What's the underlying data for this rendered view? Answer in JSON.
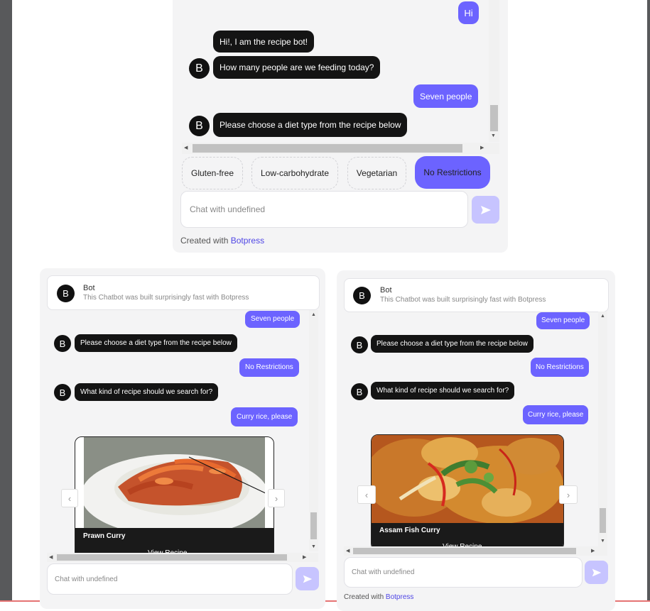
{
  "top_chat": {
    "messages": [
      {
        "from": "user",
        "text": "Hi"
      },
      {
        "from": "bot",
        "text": "Hi!, I am the recipe bot!"
      },
      {
        "from": "bot",
        "text": "How many people are we feeding today?"
      },
      {
        "from": "user",
        "text": "Seven people"
      },
      {
        "from": "bot",
        "text": "Please choose a diet type from the recipe below"
      }
    ],
    "avatar_letter": "B",
    "choices": [
      "Gluten-free",
      "Low-carbohydrate",
      "Vegetarian",
      "No Restrictions"
    ],
    "selected_choice": "No Restrictions",
    "input_placeholder": "Chat with undefined",
    "footer_prefix": "Created with",
    "footer_link": "Botpress"
  },
  "left_chat": {
    "header_name": "Bot",
    "header_desc": "This Chatbot was built surprisingly fast with Botpress",
    "avatar_letter": "B",
    "messages": [
      {
        "from": "user",
        "text": "Seven people"
      },
      {
        "from": "bot",
        "text": "Please choose a diet type from the recipe below"
      },
      {
        "from": "user",
        "text": "No Restrictions"
      },
      {
        "from": "bot",
        "text": "What kind of recipe should we search for?"
      },
      {
        "from": "user",
        "text": "Curry rice, please"
      }
    ],
    "card_title": "Prawn Curry",
    "card_link": "View Recipe",
    "input_placeholder": "Chat with undefined"
  },
  "right_chat": {
    "header_name": "Bot",
    "header_desc": "This Chatbot was built surprisingly fast with Botpress",
    "avatar_letter": "B",
    "messages": [
      {
        "from": "user",
        "text": "Seven people"
      },
      {
        "from": "bot",
        "text": "Please choose a diet type from the recipe below"
      },
      {
        "from": "user",
        "text": "No Restrictions"
      },
      {
        "from": "bot",
        "text": "What kind of recipe should we search for?"
      },
      {
        "from": "user",
        "text": "Curry rice, please"
      }
    ],
    "card_title": "Assam Fish Curry",
    "card_link": "View Recipe",
    "input_placeholder": "Chat with undefined",
    "footer_prefix": "Created with",
    "footer_link": "Botpress"
  },
  "colors": {
    "accent": "#6c63ff",
    "bot_bubble": "#141414",
    "panel": "#f4f4f5",
    "link": "#4f46e5"
  },
  "icons": {
    "send": "send-arrow-icon",
    "next": "chevron-right-icon",
    "prev": "chevron-left-icon"
  }
}
